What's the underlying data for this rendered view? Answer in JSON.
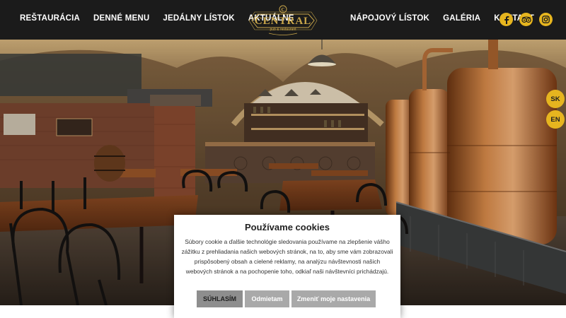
{
  "nav": {
    "left": [
      "REŠTAURÁCIA",
      "DENNÉ MENU",
      "JEDÁLNY LÍSTOK",
      "AKTUÁLNE"
    ],
    "right": [
      "NÁPOJOVÝ LÍSTOK",
      "GALÉRIA",
      "KONTAKT"
    ]
  },
  "logo": {
    "name": "CENTRAL",
    "tagline": "pub & restaurant"
  },
  "social": [
    "facebook-icon",
    "tripadvisor-icon",
    "instagram-icon"
  ],
  "languages": [
    "SK",
    "EN"
  ],
  "cookie": {
    "title": "Používame cookies",
    "text": "Súbory cookie a ďalšie technológie sledovania používame na zlepšenie vášho zážitku z prehliadania našich webových stránok, na to, aby sme vám zobrazovali prispôsobený obsah a cielené reklamy, na analýzu návštevnosti našich webových stránok a na pochopenie toho, odkiaľ naši návštevníci prichádzajú.",
    "accept_label": "SÚHLASÍM",
    "decline_label": "Odmietam",
    "settings_label": "Zmeniť moje nastavenia"
  },
  "colors": {
    "accent": "#e6b51f",
    "header_bg": "#1b1b1b",
    "logo_gold": "#c9a64a"
  }
}
